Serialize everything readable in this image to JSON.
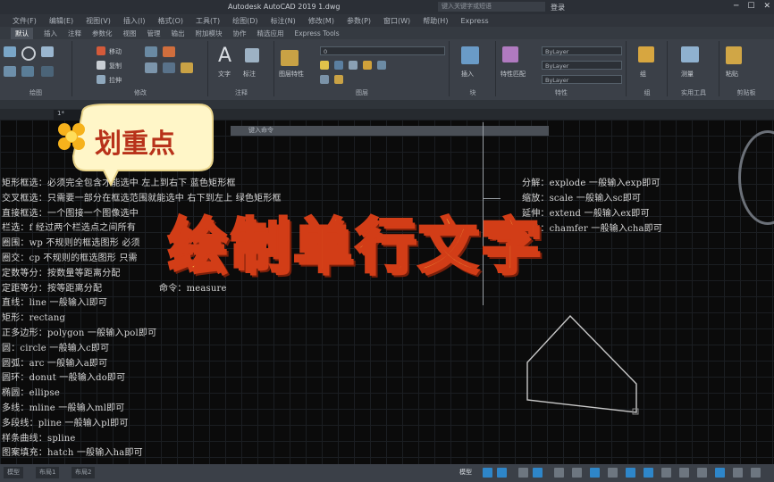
{
  "window": {
    "title": "Autodesk AutoCAD 2019    1.dwg",
    "search_placeholder": "键入关键字或短语",
    "login": "登录"
  },
  "menubar": [
    "文件(F)",
    "编辑(E)",
    "视图(V)",
    "插入(I)",
    "格式(O)",
    "工具(T)",
    "绘图(D)",
    "标注(N)",
    "修改(M)",
    "参数(P)",
    "窗口(W)",
    "帮助(H)",
    "Express"
  ],
  "ribbon_tabs": [
    "默认",
    "插入",
    "注释",
    "参数化",
    "视图",
    "管理",
    "输出",
    "附加模块",
    "协作",
    "精选应用",
    "Express Tools"
  ],
  "ribbon": {
    "draw_label": "绘图",
    "modify_label": "修改",
    "annotation_label": "注释",
    "layers_label": "图层",
    "block_label": "块",
    "properties_label": "特性",
    "groups_label": "组",
    "utilities_label": "实用工具",
    "clipboard_label": "剪贴板",
    "move": "移动",
    "copy": "复制",
    "stretch": "拉伸",
    "text": "文字",
    "dimension": "标注",
    "layer_props": "图层特性",
    "insert": "插入",
    "match": "特性匹配",
    "layer_value": "0",
    "bylayer1": "ByLayer",
    "bylayer2": "ByLayer",
    "bylayer3": "ByLayer",
    "group": "组",
    "measure": "测量",
    "paste": "粘贴"
  },
  "file_tab": "1*",
  "command_placeholder": "键入命令",
  "notes_left": [
    "矩形框选：必须完全包含才能选中   左上到右下     蓝色矩形框",
    "交叉框选：只需要一部分在框选范围就能选中   右下到左上   绿色矩形框",
    "直接框选：一个图接一个图像选中",
    "栏选：f 经过两个栏选点之间所有",
    "圈围：wp 不规则的框选图形 必须",
    "圈交：cp 不规则的框选图形 只需",
    "定数等分：按数量等距离分配",
    "定距等分：按等距离分配",
    "直线：line 一般输入l即可",
    "矩形：rectang",
    "正多边形：polygon 一般输入pol即可",
    "圆：circle 一般输入c即可",
    "圆弧：arc 一般输入a即可",
    "圆环：donut 一般输入do即可",
    "椭圆：ellipse",
    "多线：mline 一般输入ml即可",
    "多段线：pline 一般输入pl即可",
    "样条曲线：spline",
    "图案填充：hatch 一般输入ha即可"
  ],
  "notes_left_extra": [
    "命令：measure"
  ],
  "notes_right": [
    "分解：explode 一般输入exp即可",
    "缩放：scale 一般输入sc即可",
    "延伸：extend 一般输入ex即可",
    "倒角：chamfer 一般输入cha即可"
  ],
  "sticker_text": "划重点",
  "overlay_title": "绘制单行文字",
  "status": {
    "model": "模型",
    "layout1": "布局1",
    "layout2": "布局2"
  },
  "colors": {
    "overlay_fill": "#ffe35a",
    "overlay_stroke": "#d23d17",
    "sticker_fill": "#fff6c8",
    "sticker_text": "#b8321a",
    "canvas": "#0b0b0b"
  }
}
